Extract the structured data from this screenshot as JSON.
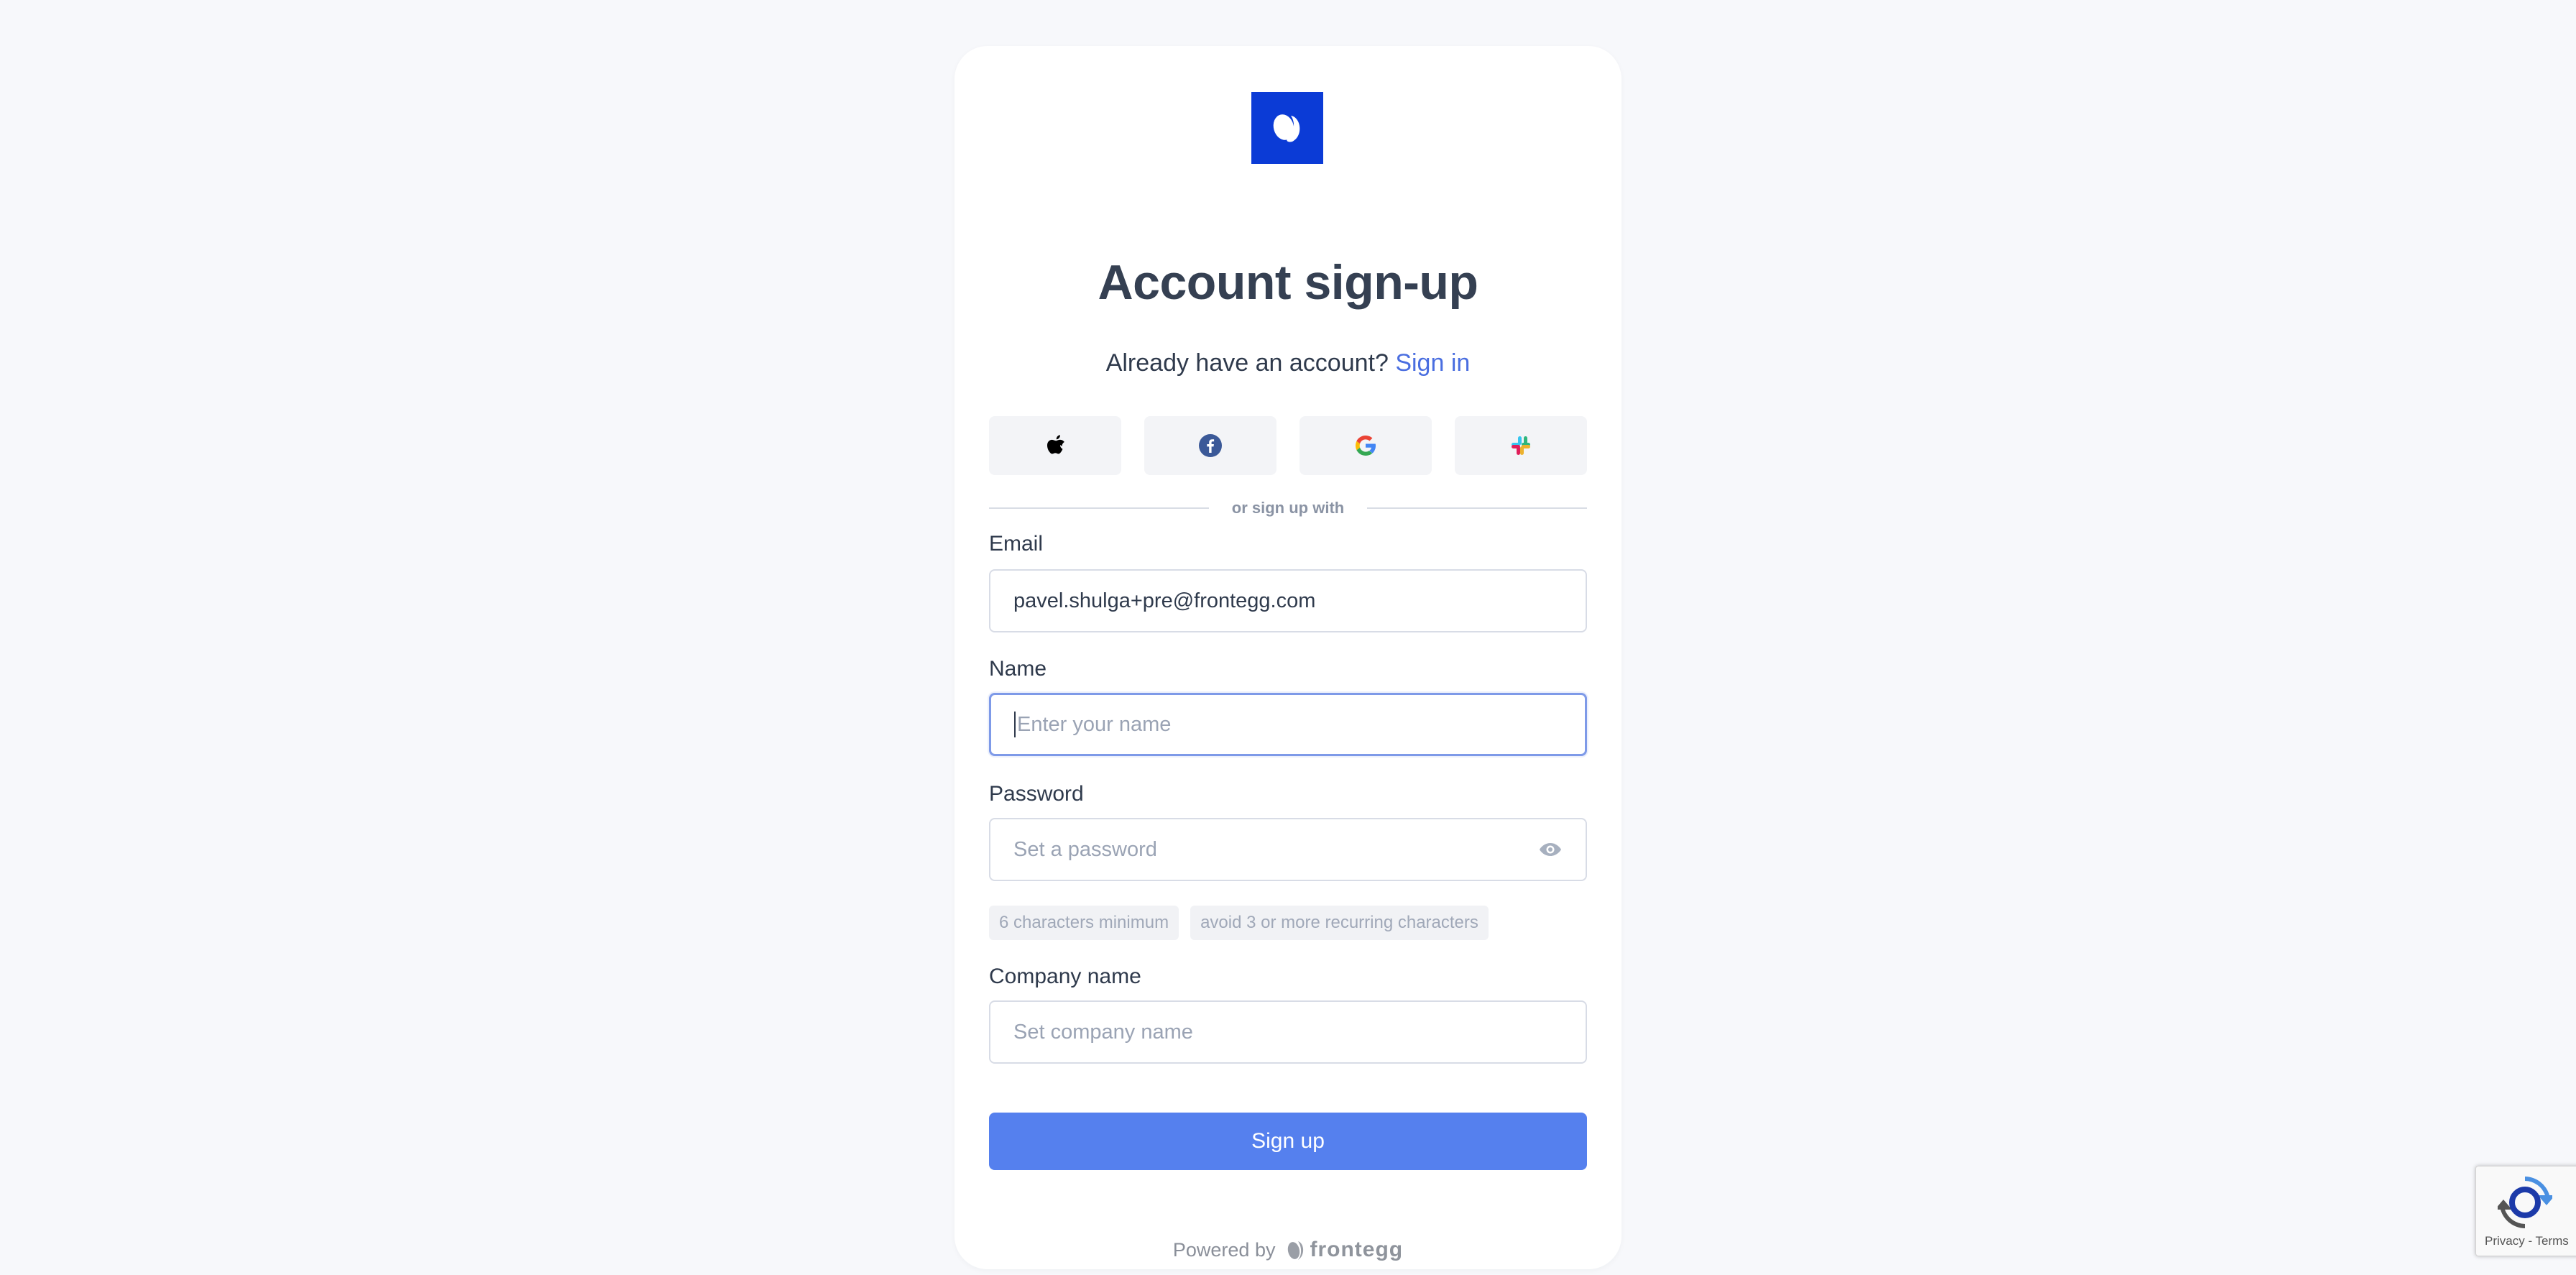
{
  "header": {
    "title": "Account sign-up",
    "subtitle_text": "Already have an account?",
    "signin_link": "Sign in"
  },
  "social": [
    {
      "icon": "apple-icon"
    },
    {
      "icon": "facebook-icon"
    },
    {
      "icon": "google-icon"
    },
    {
      "icon": "slack-icon"
    }
  ],
  "divider_text": "or sign up with",
  "form": {
    "email": {
      "label": "Email",
      "value": "pavel.shulga+pre@frontegg.com"
    },
    "name": {
      "label": "Name",
      "placeholder": "Enter your name"
    },
    "password": {
      "label": "Password",
      "placeholder": "Set a password"
    },
    "password_hints": [
      "6 characters minimum",
      "avoid 3 or more recurring characters"
    ],
    "company": {
      "label": "Company name",
      "placeholder": "Set company name"
    },
    "submit_label": "Sign up"
  },
  "footer": {
    "powered_by": "Powered by",
    "brand": "frontegg"
  },
  "recaptcha": {
    "terms": "Privacy - Terms"
  },
  "colors": {
    "accent": "#5580ee",
    "logo_bg": "#0b3bd6",
    "link": "#4a6ee0"
  }
}
